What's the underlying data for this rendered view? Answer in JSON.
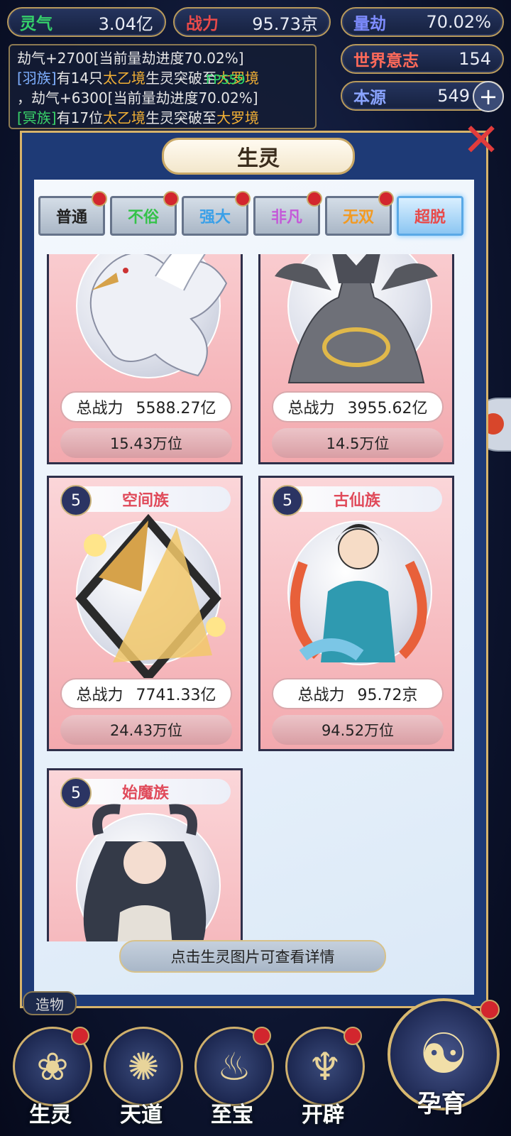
{
  "resources": [
    {
      "label": "灵气",
      "value": "3.04亿",
      "color": "#35d06a"
    },
    {
      "label": "战力",
      "value": "95.73京",
      "color": "#e94a4a"
    },
    {
      "label": "量劫",
      "value": "70.02%",
      "color": "#7e8cff"
    },
    {
      "label": "世界意志",
      "value": "154",
      "color": "#ff6a5a"
    },
    {
      "label": "本源",
      "value": "549",
      "color": "#8aa4ff"
    }
  ],
  "log": {
    "line1": "劫气+2700[当前量劫进度70.02%]",
    "line2_tag": "[羽族]",
    "line2_a": "有14只",
    "line2_gold1": "太乙境",
    "line2_b": "生灵突破至",
    "line2_gold2": "大罗境",
    "line3": "，劫气+6300[当前量劫进度70.02%]",
    "line4_tag": "[冥族]",
    "line4_a": "有17位",
    "line4_gold1": "太乙境",
    "line4_b": "生灵突破至",
    "line4_gold2": "大罗境"
  },
  "fps": "FPS59",
  "panel": {
    "title": "生灵",
    "hint": "点击生灵图片可查看详情"
  },
  "tabs": [
    {
      "label": "普通",
      "color": "#222222"
    },
    {
      "label": "不俗",
      "color": "#35c24a"
    },
    {
      "label": "强大",
      "color": "#3aa0e8"
    },
    {
      "label": "非凡",
      "color": "#c45ad8"
    },
    {
      "label": "无双",
      "color": "#f29a22"
    },
    {
      "label": "超脱",
      "color": "#e84a4a"
    }
  ],
  "cards": [
    {
      "power_label": "总战力",
      "power": "5588.27亿",
      "rank": "15.43万位",
      "icon": "white-phoenix-icon"
    },
    {
      "power_label": "总战力",
      "power": "3955.62亿",
      "rank": "14.5万位",
      "icon": "three-headed-dragon-icon"
    },
    {
      "level": "5",
      "name": "空间族",
      "power_label": "总战力",
      "power": "7741.33亿",
      "rank": "24.43万位",
      "icon": "golden-pyramid-icon"
    },
    {
      "level": "5",
      "name": "古仙族",
      "power_label": "总战力",
      "power": "95.72京",
      "rank": "94.52万位",
      "icon": "immortal-maiden-icon"
    },
    {
      "level": "5",
      "name": "始魔族",
      "icon": "horned-demon-girl-icon"
    }
  ],
  "bottom_nav": {
    "zaowu": "造物",
    "items": [
      "生灵",
      "天道",
      "至宝",
      "开辟"
    ],
    "big": "孕育"
  }
}
